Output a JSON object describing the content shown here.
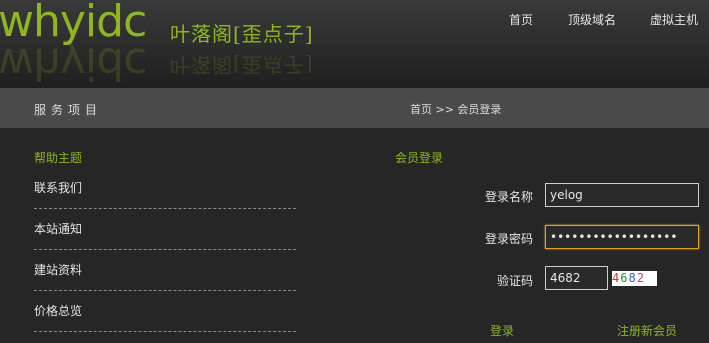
{
  "header": {
    "logo_text": "whyidc",
    "site_name": "叶落阁[歪点子]",
    "nav": [
      "首页",
      "顶级域名",
      "虚拟主机"
    ]
  },
  "bar": {
    "title": "服务项目",
    "breadcrumb": "首页 >> 会员登录"
  },
  "sidebar": {
    "title": "帮助主题",
    "items": [
      "联系我们",
      "本站通知",
      "建站资料",
      "价格总览"
    ]
  },
  "login": {
    "title": "会员登录",
    "username_label": "登录名称",
    "username_value": "yelog",
    "password_label": "登录密码",
    "password_value": "••••••••••••••••••",
    "captcha_label": "验证码",
    "captcha_value": "4682",
    "captcha_image_text": "4682",
    "login_button": "登录",
    "register_link": "注册新会员"
  },
  "colors": {
    "accent": "#8fb521",
    "background": "#262626",
    "bar": "#4a4a4a",
    "focus": "#e0a22a"
  }
}
